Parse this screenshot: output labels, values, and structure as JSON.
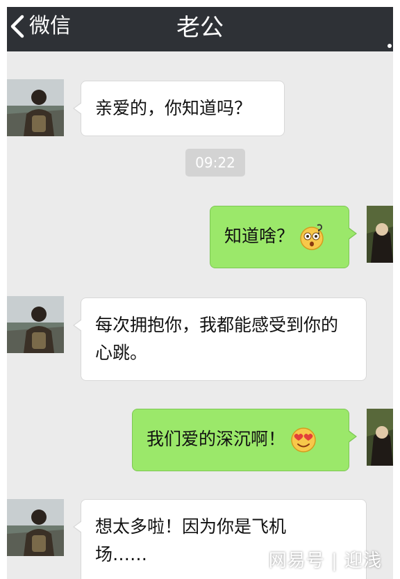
{
  "nav": {
    "back_label": "微信",
    "title": "老公",
    "back_icon": "chevron-left-icon",
    "more_icon": "more-icon"
  },
  "colors": {
    "nav_bg": "#2e3136",
    "chat_bg": "#ebebeb",
    "incoming_bubble": "#ffffff",
    "outgoing_bubble": "#9be86a"
  },
  "messages": [
    {
      "direction": "incoming",
      "text": "亲爱的，你知道吗？"
    },
    {
      "direction": "outgoing",
      "text": "知道啥？",
      "emoji": "dizzy-face-emoji"
    },
    {
      "direction": "incoming",
      "text": "每次拥抱你，我都能感受到你的心跳。"
    },
    {
      "direction": "outgoing",
      "text": "我们爱的深沉啊！",
      "emoji": "heart-eyes-emoji"
    },
    {
      "direction": "incoming",
      "text": "想太多啦！因为你是飞机场……"
    }
  ],
  "timestamp": "09:22",
  "watermark": "网易号 | 迎浅"
}
